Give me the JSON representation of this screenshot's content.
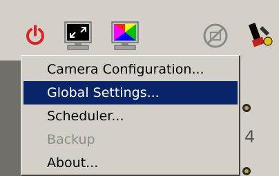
{
  "toolbar": {
    "icons": [
      {
        "name": "power-icon",
        "color": "#e02020"
      },
      {
        "name": "monitor-fullscreen-icon"
      },
      {
        "name": "monitor-color-icon"
      },
      {
        "name": "no-camera-icon"
      },
      {
        "name": "tools-icon"
      }
    ]
  },
  "menu": {
    "items": [
      {
        "label": "Camera Configuration...",
        "state": "normal"
      },
      {
        "label": "Global Settings...",
        "state": "selected"
      },
      {
        "label": "Scheduler...",
        "state": "normal"
      },
      {
        "label": "Backup",
        "state": "disabled"
      },
      {
        "label": "About...",
        "state": "normal"
      }
    ]
  },
  "background_panel": {
    "partial_text": "4"
  },
  "colors": {
    "selection": "#0a246a",
    "face": "#d4d0c8",
    "disabled_text": "#8c8c8c"
  }
}
